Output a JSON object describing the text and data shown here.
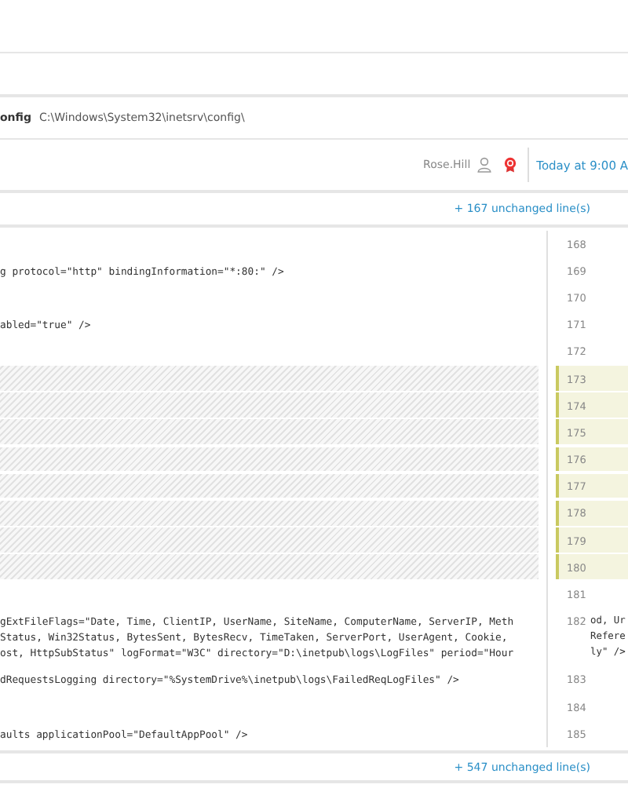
{
  "file_bar": {
    "name": "onfig",
    "path": "C:\\Windows\\System32\\inetsrv\\config\\"
  },
  "meta_bar": {
    "author": "Rose.Hill",
    "time": "Today at 9:00 A"
  },
  "top_unchanged": "+ 167 unchanged line(s)",
  "rows": [
    {
      "number": "168",
      "kind": "unchanged",
      "left": [],
      "right": []
    },
    {
      "number": "169",
      "kind": "unchanged",
      "left": [
        "g protocol=\"http\" bindingInformation=\"*:80:\" />"
      ],
      "right": []
    },
    {
      "number": "170",
      "kind": "unchanged",
      "left": [],
      "right": []
    },
    {
      "number": "171",
      "kind": "unchanged",
      "left": [
        "abled=\"true\" />"
      ],
      "right": []
    },
    {
      "number": "172",
      "kind": "unchanged",
      "left": [],
      "right": []
    },
    {
      "number": "173",
      "kind": "added",
      "left": [],
      "right": []
    },
    {
      "number": "174",
      "kind": "added",
      "left": [],
      "right": []
    },
    {
      "number": "175",
      "kind": "added",
      "left": [],
      "right": []
    },
    {
      "number": "176",
      "kind": "added",
      "left": [],
      "right": []
    },
    {
      "number": "177",
      "kind": "added",
      "left": [],
      "right": []
    },
    {
      "number": "178",
      "kind": "added",
      "left": [],
      "right": []
    },
    {
      "number": "179",
      "kind": "added",
      "left": [],
      "right": []
    },
    {
      "number": "180",
      "kind": "added",
      "left": [],
      "right": []
    },
    {
      "number": "181",
      "kind": "unchanged",
      "left": [],
      "right": []
    },
    {
      "number": "182",
      "kind": "unchanged",
      "left": [
        "gExtFileFlags=\"Date, Time, ClientIP, UserName, SiteName, ComputerName, ServerIP, Meth",
        "Status, Win32Status, BytesSent, BytesRecv, TimeTaken, ServerPort, UserAgent, Cookie,",
        "ost, HttpSubStatus\" logFormat=\"W3C\" directory=\"D:\\inetpub\\logs\\LogFiles\" period=\"Hour"
      ],
      "right": [
        "od, Ur",
        "Refere",
        "ly\" />"
      ]
    },
    {
      "number": "183",
      "kind": "unchanged",
      "left": [
        "dRequestsLogging directory=\"%SystemDrive%\\inetpub\\logs\\FailedReqLogFiles\" />"
      ],
      "right": []
    },
    {
      "number": "184",
      "kind": "unchanged",
      "left": [],
      "right": []
    },
    {
      "number": "185",
      "kind": "unchanged",
      "left": [
        "aults applicationPool=\"DefaultAppPool\" />"
      ],
      "right": []
    }
  ],
  "bottom_unchanged": "+ 547 unchanged line(s)"
}
